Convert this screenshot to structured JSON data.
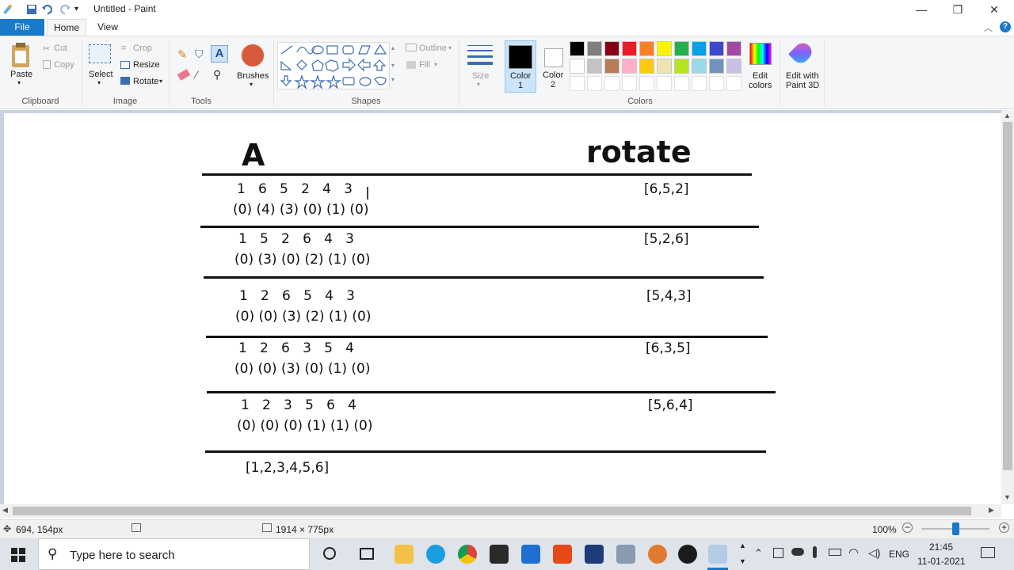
{
  "window": {
    "title": "Untitled - Paint",
    "controls": [
      "—",
      "❐",
      "✕"
    ]
  },
  "menu": {
    "file": "File",
    "tabs": [
      "Home",
      "View"
    ]
  },
  "ribbon": {
    "clipboard": {
      "paste": "Paste",
      "cut": "Cut",
      "copy": "Copy",
      "label": "Clipboard"
    },
    "image": {
      "select": "Select",
      "crop": "Crop",
      "resize": "Resize",
      "rotate": "Rotate",
      "label": "Image"
    },
    "tools": {
      "label": "Tools"
    },
    "brushes": "Brushes",
    "shapes": {
      "outline": "Outline",
      "fill": "Fill",
      "label": "Shapes"
    },
    "size": "Size",
    "color1": [
      "Color",
      "1"
    ],
    "color2": [
      "Color",
      "2"
    ],
    "colors_label": "Colors",
    "edit_colors": [
      "Edit",
      "colors"
    ],
    "paint3d": [
      "Edit with",
      "Paint 3D"
    ],
    "palette_row1": [
      "#000000",
      "#7f7f7f",
      "#880015",
      "#ed1c24",
      "#ff7f27",
      "#fff200",
      "#22b14c",
      "#00a2e8",
      "#3f48cc",
      "#a349a4"
    ],
    "palette_row2": [
      "#ffffff",
      "#c3c3c3",
      "#b97a57",
      "#ffaec9",
      "#ffc90e",
      "#efe4b0",
      "#b5e61d",
      "#99d9ea",
      "#7092be",
      "#c8bfe7"
    ],
    "primary_color": "#000000",
    "secondary_color": "#ffffff"
  },
  "canvas": {
    "heading_left": "A",
    "heading_right": "rotate",
    "rows": [
      {
        "values": "1   6   5   2   4   3",
        "indices": "(0) (4) (3) (0) (1) (0)",
        "rotate": "[6,5,2]"
      },
      {
        "values": "1   5   2   6   4   3",
        "indices": "(0) (3) (0) (2) (1) (0)",
        "rotate": "[5,2,6]"
      },
      {
        "values": "1   2   6   5   4   3",
        "indices": "(0) (0) (3) (2) (1) (0)",
        "rotate": "[5,4,3]"
      },
      {
        "values": "1   2   6   3   5   4",
        "indices": "(0) (0) (3) (0) (1) (0)",
        "rotate": "[6,3,5]"
      },
      {
        "values": "1   2   3   5   6   4",
        "indices": "(0) (0) (0) (1) (1) (0)",
        "rotate": "[5,6,4]"
      }
    ],
    "result": "[1,2,3,4,5,6]"
  },
  "status": {
    "cursor_pos": "694, 154px",
    "image_size": "1914 × 775px",
    "zoom": "100%",
    "zoom_level": 0.5
  },
  "taskbar": {
    "search_placeholder": "Type here to search",
    "language": "ENG",
    "time": "21:45",
    "date": "11-01-2021"
  }
}
